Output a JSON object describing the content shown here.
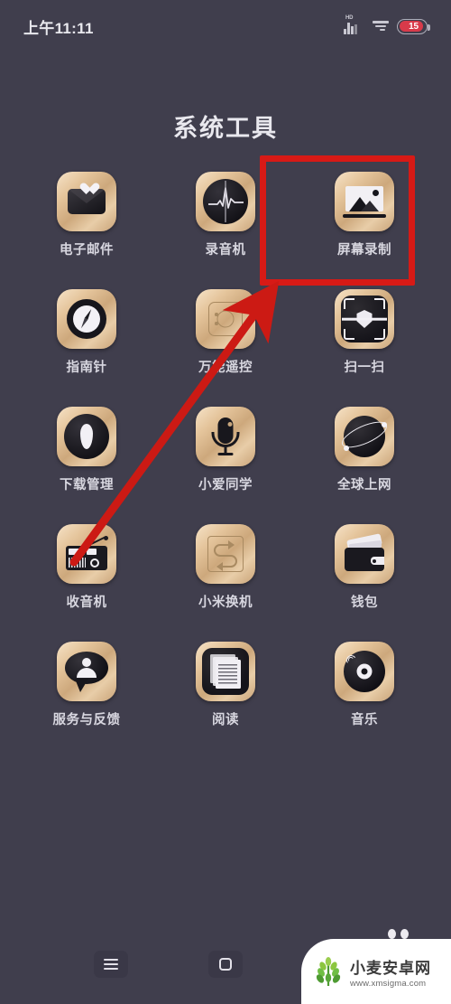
{
  "status_bar": {
    "time": "上午11:11",
    "network_label": "HD",
    "battery_level": "15",
    "signal_icon": "signal-bars-icon",
    "data_icon": "data-signal-icon",
    "battery_icon": "battery-icon"
  },
  "header": {
    "title": "系统工具"
  },
  "apps": [
    [
      {
        "label": "电子邮件",
        "icon": "email-icon"
      },
      {
        "label": "录音机",
        "icon": "recorder-icon"
      },
      {
        "label": "屏幕录制",
        "icon": "screen-record-icon",
        "highlighted": true
      }
    ],
    [
      {
        "label": "指南针",
        "icon": "compass-icon"
      },
      {
        "label": "万能遥控",
        "icon": "remote-control-icon"
      },
      {
        "label": "扫一扫",
        "icon": "scan-icon"
      }
    ],
    [
      {
        "label": "下载管理",
        "icon": "download-manager-icon"
      },
      {
        "label": "小爱同学",
        "icon": "voice-assistant-icon"
      },
      {
        "label": "全球上网",
        "icon": "global-internet-icon"
      }
    ],
    [
      {
        "label": "收音机",
        "icon": "radio-icon"
      },
      {
        "label": "小米换机",
        "icon": "mi-mover-icon"
      },
      {
        "label": "钱包",
        "icon": "wallet-icon"
      }
    ],
    [
      {
        "label": "服务与反馈",
        "icon": "feedback-icon"
      },
      {
        "label": "阅读",
        "icon": "reading-icon"
      },
      {
        "label": "音乐",
        "icon": "music-icon"
      }
    ]
  ],
  "annotations": {
    "highlight_color": "#D71A16",
    "highlight_target": "屏幕录制",
    "arrow_color": "#CC1A14"
  },
  "navbar": {
    "menu_label": "menu-button",
    "home_label": "home-button",
    "back_label": "back-button"
  },
  "watermark": {
    "title": "小麦安卓网",
    "url": "www.xmsigma.com",
    "logo": "wheat-logo-icon"
  },
  "colors": {
    "background": "#403E4D",
    "icon_gold": "#E5C59C",
    "text": "#D8D7E0",
    "battery_red": "#D83A4A",
    "watermark_green": "#6FBE44"
  }
}
